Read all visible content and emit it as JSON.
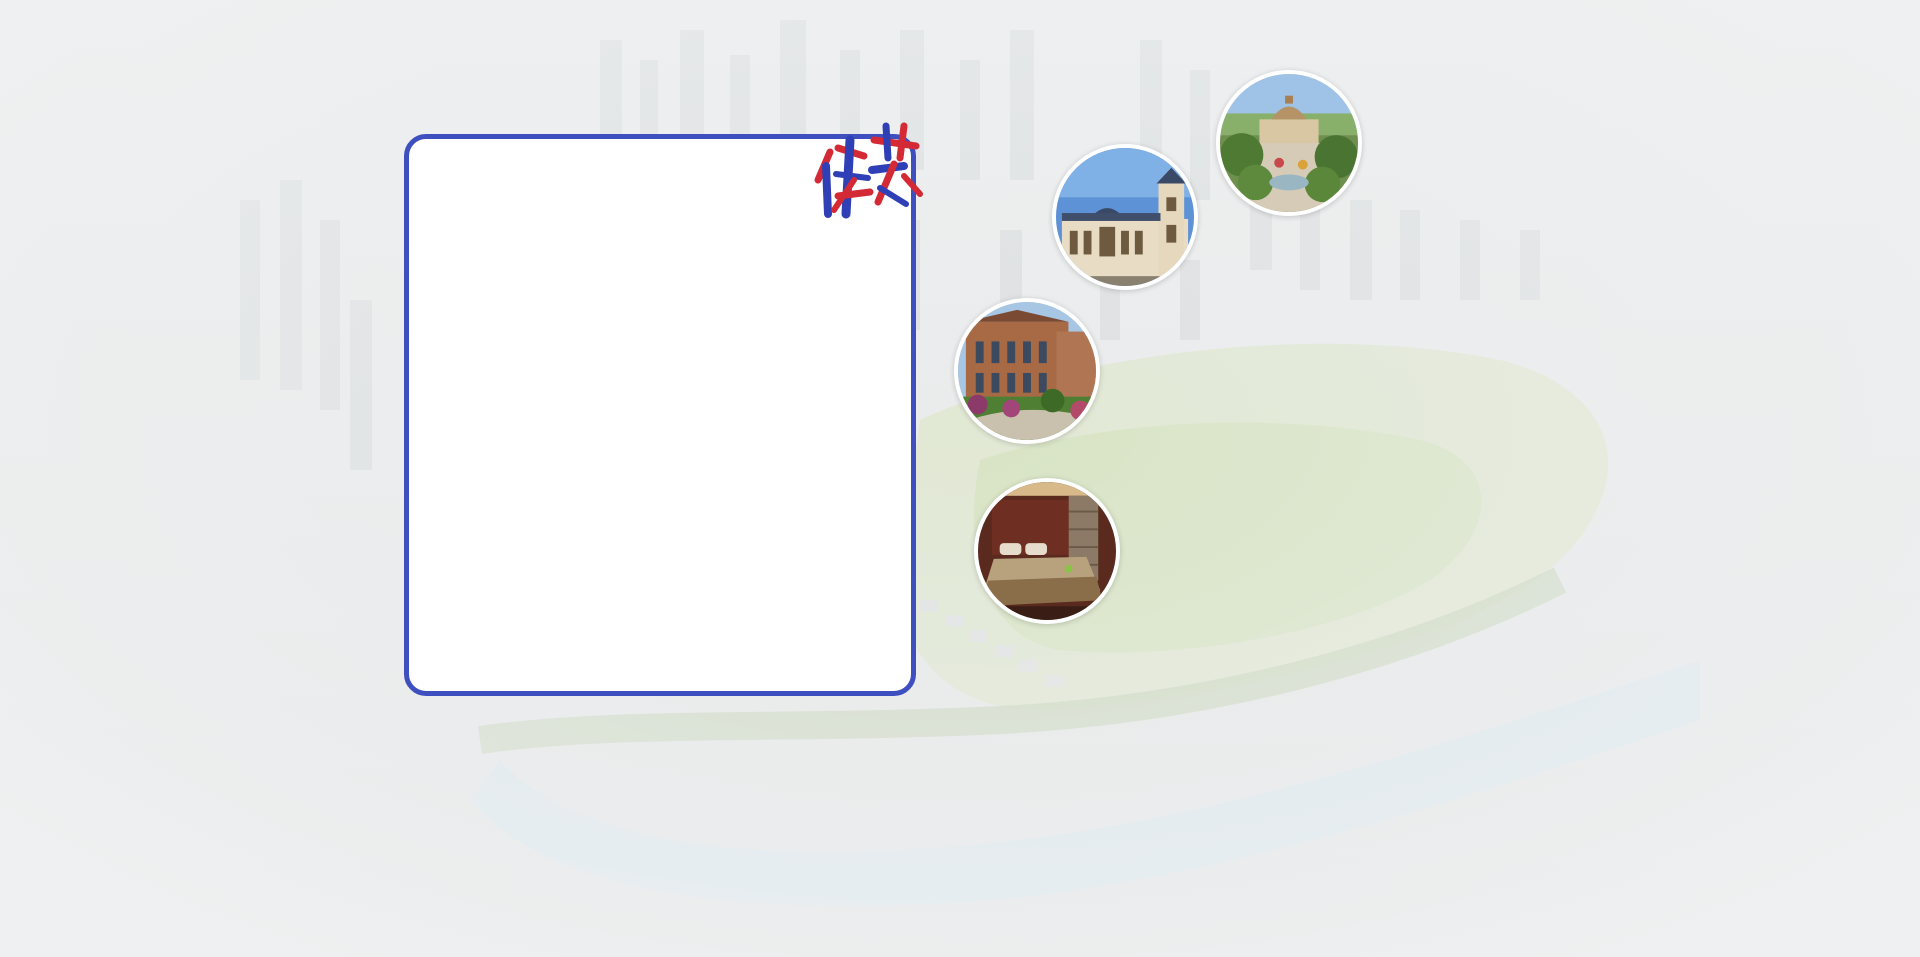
{
  "card": {
    "badge_text": "佳苑"
  },
  "bubbles": [
    {
      "name": "garden-pavilion-photo"
    },
    {
      "name": "clubhouse-facade-photo"
    },
    {
      "name": "brick-mansion-photo"
    },
    {
      "name": "hotel-bedroom-photo"
    }
  ],
  "colors": {
    "card_border": "#3e4fbf",
    "badge_red": "#d32a35",
    "badge_blue": "#2f3fb6"
  }
}
